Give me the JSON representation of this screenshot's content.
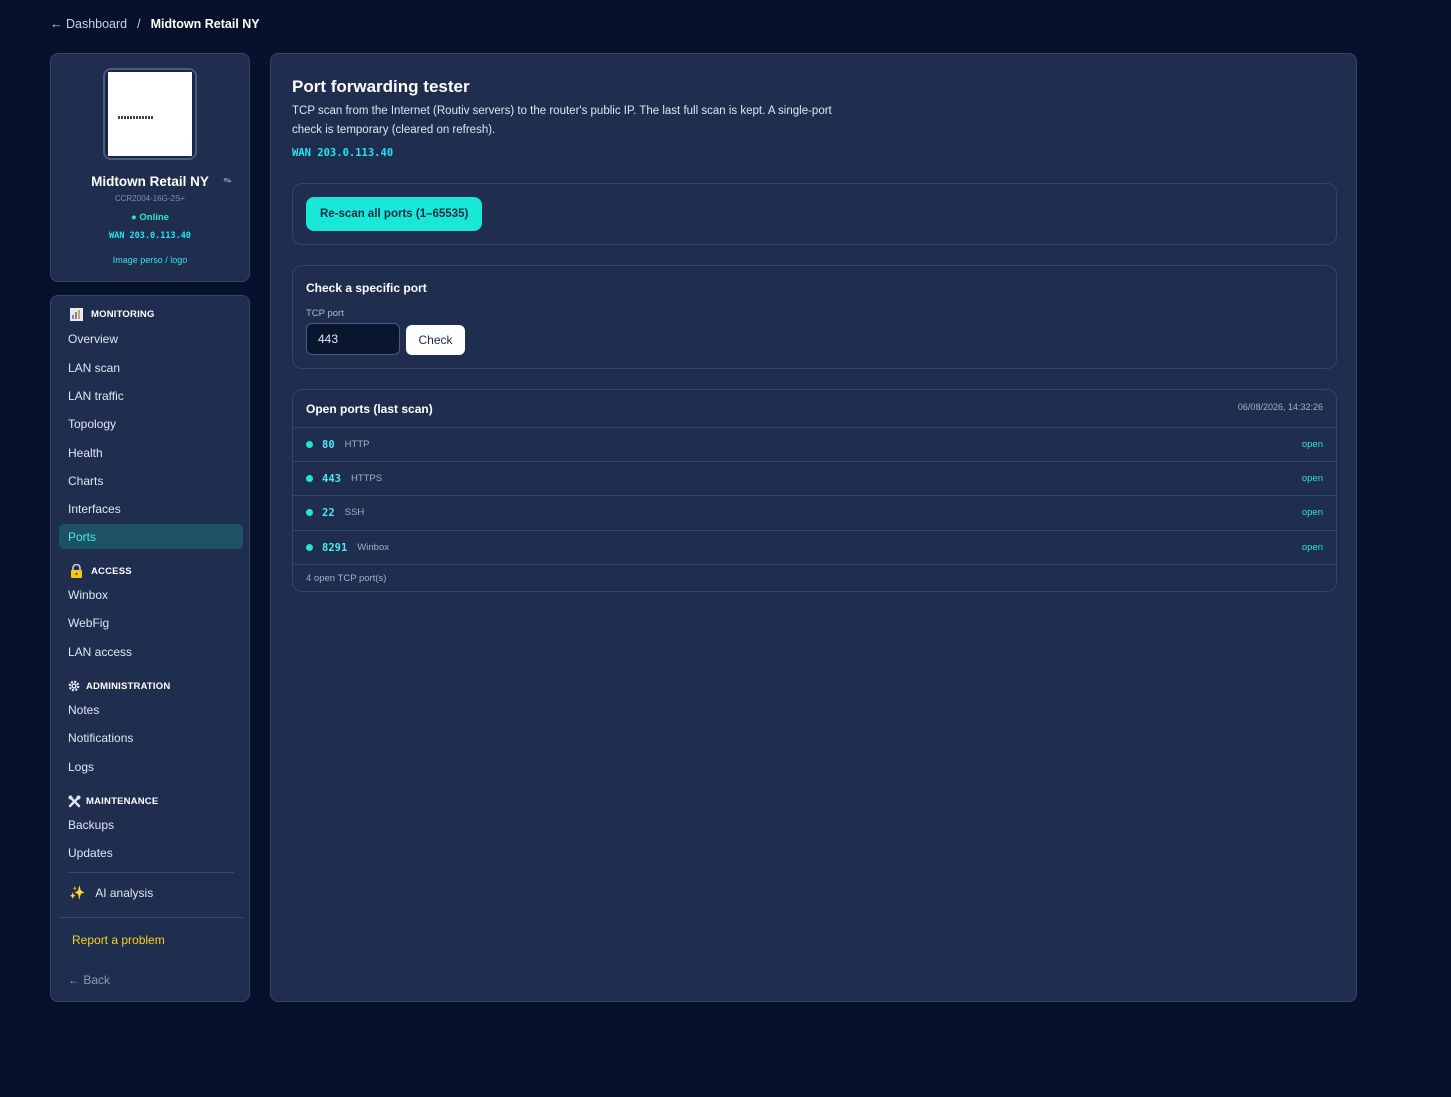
{
  "breadcrumb": {
    "back": "← Dashboard",
    "separator": "/",
    "current": "Midtown Retail NY"
  },
  "device": {
    "name": "Midtown Retail NY",
    "model": "CCR2004-16G-2S+",
    "status": "● Online",
    "wan": "WAN 203.0.113.40",
    "logo_link": "Image perso / logo"
  },
  "sidebar": {
    "sections": [
      {
        "title": "MONITORING",
        "icon": "chart-icon"
      },
      {
        "title": "ACCESS",
        "icon": "lock-icon"
      },
      {
        "title": "ADMINISTRATION",
        "icon": "gear-icon"
      },
      {
        "title": "MAINTENANCE",
        "icon": "tools-icon"
      }
    ],
    "monitoring": [
      "Overview",
      "LAN scan",
      "LAN traffic",
      "Topology",
      "Health",
      "Charts",
      "Interfaces",
      "Ports"
    ],
    "access": [
      "Winbox",
      "WebFig",
      "LAN access"
    ],
    "administration": [
      "Notes",
      "Notifications",
      "Logs"
    ],
    "maintenance": [
      "Backups",
      "Updates"
    ],
    "ai": "AI analysis",
    "report": "Report a problem",
    "back": "← Back",
    "active": "Ports"
  },
  "main": {
    "title": "Port forwarding tester",
    "description": "TCP scan from the Internet (Routiv servers) to the router's public IP. The last full scan is kept. A single-port check is temporary (cleared on refresh).",
    "wan": "WAN 203.0.113.40",
    "rescan_label": "Re-scan all ports (1–65535)",
    "check": {
      "title": "Check a specific port",
      "label": "TCP port",
      "value": "443",
      "button": "Check"
    },
    "ports": {
      "title": "Open ports (last scan)",
      "timestamp": "06/08/2026, 14:32:26",
      "rows": [
        {
          "port": "80",
          "service": "HTTP",
          "state": "open"
        },
        {
          "port": "443",
          "service": "HTTPS",
          "state": "open"
        },
        {
          "port": "22",
          "service": "SSH",
          "state": "open"
        },
        {
          "port": "8291",
          "service": "Winbox",
          "state": "open"
        }
      ],
      "footer": "4 open TCP port(s)"
    }
  },
  "colors": {
    "background": "#08112b",
    "panel": "#1f2d4f",
    "accent": "#19e8d8",
    "active_nav": "#1c5264",
    "report": "#f5d31c"
  }
}
